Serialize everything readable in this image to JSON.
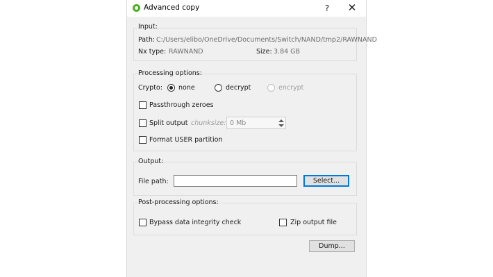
{
  "window": {
    "title": "Advanced copy",
    "help_label": "?",
    "close_label": "✕"
  },
  "input_group": {
    "title": "Input:",
    "path_label": "Path:",
    "path_value": "C:/Users/elibo/OneDrive/Documents/Switch/NAND/tmp2/RAWNAND",
    "nxtype_label": "Nx type:",
    "nxtype_value": "RAWNAND",
    "size_label": "Size:",
    "size_value": "3.84 GB"
  },
  "processing_group": {
    "title": "Processing options:",
    "crypto_label": "Crypto:",
    "crypto_options": [
      "none",
      "decrypt",
      "encrypt"
    ],
    "crypto_selected": "none",
    "passthrough_label": "Passthrough zeroes",
    "split_label": "Split output",
    "chunksize_label": "chunksize:",
    "chunksize_value": "0 Mb",
    "format_label": "Format USER partition"
  },
  "output_group": {
    "title": "Output:",
    "filepath_label": "File path:",
    "filepath_value": "",
    "select_label": "Select..."
  },
  "post_group": {
    "title": "Post-processing options:",
    "bypass_label": "Bypass data integrity check",
    "zip_label": "Zip output file"
  },
  "footer": {
    "dump_label": "Dump..."
  }
}
